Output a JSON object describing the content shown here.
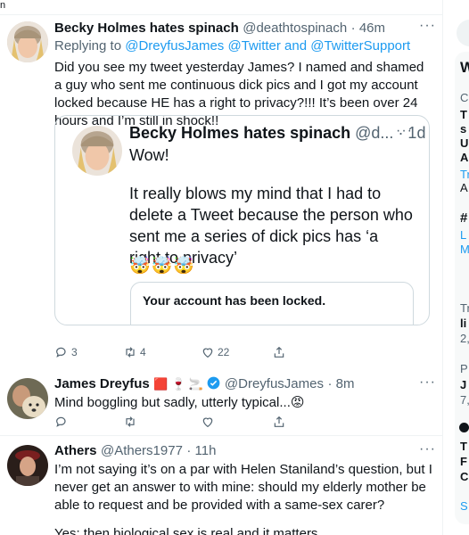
{
  "top_stub": "n",
  "tweets": [
    {
      "name": "Becky Holmes hates spinach",
      "handle": "@deathtospinach",
      "time": "· 46m",
      "reply_prefix": "Replying to",
      "reply_to": "@DreyfusJames @Twitter and @TwitterSupport",
      "text": "Did you see my tweet yesterday James? I named and shamed a guy who sent me continuous dick pics and I got my account locked because HE has a right to privacy?!!! It’s been over 24 hours and I’m still in shock!!",
      "reply_count": "3",
      "retweet_count": "4",
      "like_count": "22"
    },
    {
      "name": "James Dreyfus",
      "badges": "🟥 🍷 🚬",
      "handle": "@DreyfusJames",
      "time": "· 8m",
      "text": "Mind boggling but sadly, utterly typical...😡"
    },
    {
      "name": "Athers",
      "handle": "@Athers1977",
      "time": "· 11h",
      "text": "I’m not saying it’s on a par with Helen Staniland’s question, but I never get an answer to with mine: should my elderly mother be able to request and be provided with a same-sex carer?",
      "text2": "Yes: then biological sex is real and it matters."
    }
  ],
  "quote": {
    "name": "Becky Holmes hates spinach",
    "handle": "@d...",
    "time": "· 1d",
    "line1": "Wow!",
    "line2": "It really blows my mind that I had to delete a Tweet because the person who sent me a series of dick pics has ‘a right to privacy’",
    "emojis": "🤯🤯🤯",
    "card_title": "Your account has been locked."
  },
  "sidebar": {
    "letters": [
      "W",
      "C",
      "T",
      "s",
      "U",
      "A",
      "Tr",
      "A",
      "#",
      "L",
      "M",
      "Tr",
      "li",
      "2,",
      "P",
      "J",
      "7,",
      "T",
      "F",
      "C",
      "S"
    ]
  }
}
